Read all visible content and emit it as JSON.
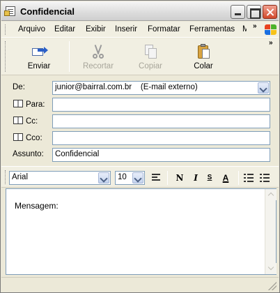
{
  "window": {
    "title": "Confidencial"
  },
  "menu": {
    "items": [
      "Arquivo",
      "Editar",
      "Exibir",
      "Inserir",
      "Formatar",
      "Ferramentas",
      "M"
    ],
    "overflow": "»"
  },
  "toolbar": {
    "send_label": "Enviar",
    "cut_label": "Recortar",
    "copy_label": "Copiar",
    "paste_label": "Colar",
    "overflow": "»"
  },
  "fields": {
    "from_label": "De:",
    "from_value": "junior@bairral.com.br    (E-mail externo)",
    "to_label": "Para:",
    "to_value": "",
    "cc_label": "Cc:",
    "cc_value": "",
    "bcc_label": "Cco:",
    "bcc_value": "",
    "subject_label": "Assunto:",
    "subject_value": "Confidencial"
  },
  "format": {
    "font": "Arial",
    "size": "10",
    "bold": "N",
    "italic": "I",
    "underline": "S",
    "font_color": "A"
  },
  "body": {
    "text": "Mensagem:"
  },
  "colors": {
    "window_bg": "#ece9d8",
    "bar_bg": "#f1efe2",
    "input_border": "#7f9db9",
    "close_button": "#d24a2c"
  }
}
